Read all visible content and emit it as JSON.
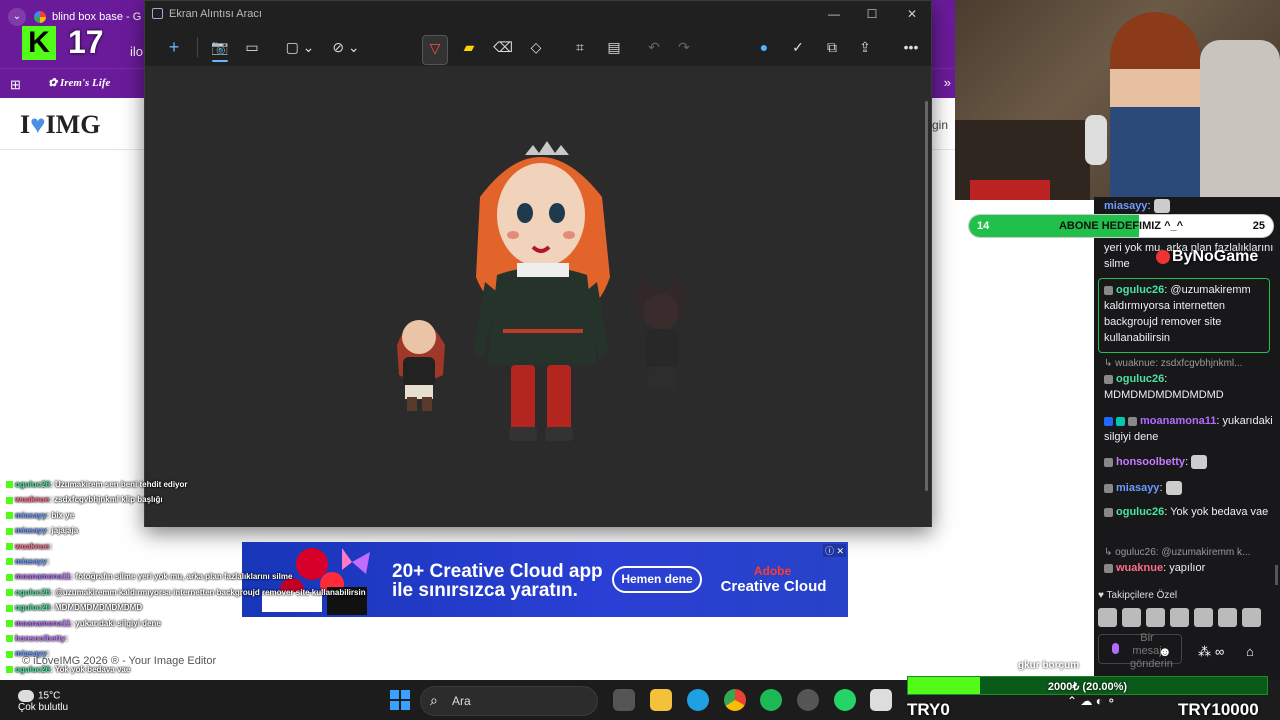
{
  "browser": {
    "tab_title": "blind box base - G",
    "url_fragment": "ilo",
    "bookmark": "Irem's Life",
    "kick_logo": "K",
    "kick_counter": "17"
  },
  "site": {
    "logo_text": "IMG",
    "login_fragment": "gin",
    "footer": "© iLoveIMG 2026 ® - Your Image Editor"
  },
  "snip": {
    "title": "Ekran Alıntısı Aracı",
    "controls": {
      "minimize": "—",
      "maximize": "☐",
      "close": "✕"
    },
    "toolbar": {
      "new": "+",
      "screenshot_mode": "screenshot",
      "video_mode": "video",
      "shape": "rectangle",
      "delay": "no-delay",
      "pen": "pen",
      "highlighter": "highlighter",
      "eraser": "eraser",
      "shapes": "shapes",
      "crop": "crop",
      "text_actions": "text-actions",
      "undo": "undo",
      "redo": "redo",
      "edit_in_paint": "paint",
      "save_check": "done",
      "copy": "copy",
      "share": "share",
      "more": "more"
    }
  },
  "ad": {
    "line1": "20+ Creative Cloud app",
    "line2": "ile sınırsızca yaratın.",
    "button": "Hemen dene",
    "brand_top": "Adobe",
    "brand": "Creative Cloud",
    "close": "ⓘ ✕"
  },
  "overlay_chat": [
    {
      "user": "oguluc26",
      "text": ": Uzumakirem sen beni tehdit ediyor"
    },
    {
      "user": "wuaknue",
      "text": ": zsdxfcgvbhjnkml klip başlığı"
    },
    {
      "user": "miasayy",
      "text": ": bix ye"
    },
    {
      "user": "miasayy",
      "text": ": jajajaja"
    },
    {
      "user": "wuaknue",
      "text": ": "
    },
    {
      "user": "miasayy",
      "text": ": "
    },
    {
      "user": "moanamona11",
      "text": ": fotoğrafın silme yeri yok mu, arka plan fazlalıklarını silme"
    },
    {
      "user": "oguluc26",
      "text": ": @uzumakiremm kaldırmıyorsa internetten backgroujd remover site kullanabilirsin"
    },
    {
      "user": "oguluc26",
      "text": ": MDMDMDMDMDMDMD"
    },
    {
      "user": "moanamona11",
      "text": ": yukarıdaki silgiyi dene"
    },
    {
      "user": "honsoolbetty",
      "text": ": "
    },
    {
      "user": "miasayy",
      "text": ": "
    },
    {
      "user": "oguluc26",
      "text": ": Yok yok bedava vae"
    },
    {
      "user": "wuaknue",
      "text": ": yapılıor"
    }
  ],
  "goal": {
    "current": "14",
    "label": "ABONE HEDEFIMIZ ^_^",
    "target": "25",
    "progress": 0.56
  },
  "chat": {
    "brand": "ByNoGame",
    "messages": {
      "m0": {
        "user": "miasayy",
        "text": ":"
      },
      "m1_user": "moanamona11",
      "m1_text": ": fotoğrafın silme yeri yok mu, arka plan fazlalıklarını silme",
      "m2_user": "oguluc26",
      "m2_text": ": @uzumakiremm kaldırmıyorsa internetten backgroujd remover site kullanabilirsin",
      "r3": "wuaknue: zsdxfcgvbhjnkml...",
      "m3_user": "oguluc26",
      "m3_text": ": MDMDMDMDMDMDMD",
      "m4_user": "moanamona11",
      "m4_text": ": yukarıdaki silgiyi dene",
      "m5_user": "honsoolbetty",
      "m5_text": ":",
      "m6_user": "miasayy",
      "m6_text": ":",
      "m7_user": "oguluc26",
      "m7_text": ": Yok yok bedava vae",
      "r8": "oguluc26: @uzumakiremm k...",
      "m8_user": "wuaknue",
      "m8_text": ": yapılıor"
    },
    "sub_only": "Takipçilere Özel",
    "input_placeholder": "Bir mesaj gönderin",
    "donor": "gkur borçum",
    "colors": {
      "miasayy": "#6b9bff",
      "moanamona11": "#b36bff",
      "oguluc26": "#4be3a0",
      "honsoolbetty": "#c67bff",
      "wuaknue": "#ff6b8a"
    }
  },
  "bottom": {
    "progress_label": "2000₺ (20.00%)",
    "progress": 0.2,
    "try_left": "TRY0",
    "try_right": "TRY10000",
    "weather_temp": "15°C",
    "weather_desc": "Çok bulutlu",
    "search": "Ara"
  }
}
